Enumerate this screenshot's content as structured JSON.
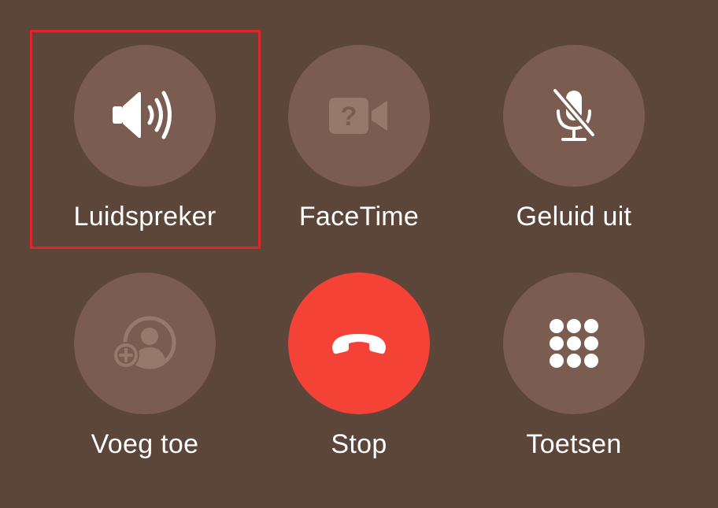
{
  "controls": {
    "speaker": {
      "label": "Luidspreker",
      "icon": "speaker-icon"
    },
    "facetime": {
      "label": "FaceTime",
      "icon": "facetime-unavailable-icon"
    },
    "mute": {
      "label": "Geluid uit",
      "icon": "mic-off-icon"
    },
    "add_call": {
      "label": "Voeg toe",
      "icon": "add-person-icon"
    },
    "end_call": {
      "label": "Stop",
      "icon": "hang-up-icon"
    },
    "keypad": {
      "label": "Toetsen",
      "icon": "keypad-icon"
    }
  },
  "colors": {
    "background": "#5c4539",
    "button": "#7a5d50",
    "end_call": "#f44336",
    "highlight": "#e0242b"
  }
}
